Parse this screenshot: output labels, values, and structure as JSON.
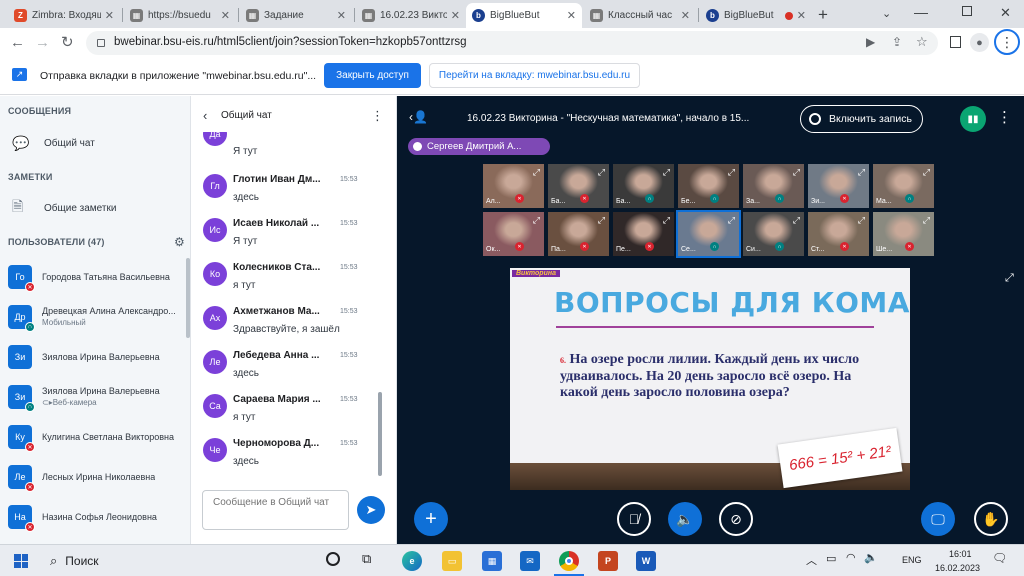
{
  "browser": {
    "tabs": [
      {
        "label": "Zimbra: Входящ",
        "fav": "Zi",
        "color": "#e04a2a"
      },
      {
        "label": "https://bsuedu",
        "fav": "b",
        "color": "#7a7a7a"
      },
      {
        "label": "Задание",
        "fav": "Z",
        "color": "#7a7a7a"
      },
      {
        "label": "16.02.23 Викто",
        "fav": "16",
        "color": "#7a7a7a"
      },
      {
        "label": "BigBlueBut",
        "fav": "b",
        "color": "#1b3f8f"
      },
      {
        "label": "Классный час",
        "fav": "K",
        "color": "#7a7a7a"
      },
      {
        "label": "BigBlueBut",
        "fav": "b",
        "color": "#1b3f8f"
      }
    ],
    "new_tab_symbol": "+",
    "url": "bwebinar.bsu-eis.ru/html5client/join?sessionToken=hzkopb57onttzrsg"
  },
  "infobar": {
    "text": "Отправка вкладки в приложение \"mwebinar.bsu.edu.ru\"...",
    "share_button": "Закрыть доступ",
    "goto_button": "Перейти на вкладку: mwebinar.bsu.edu.ru"
  },
  "sidebar": {
    "messages_header": "СООБЩЕНИЯ",
    "public_chat": "Общий чат",
    "notes_header": "ЗАМЕТКИ",
    "shared_notes": "Общие заметки",
    "users_header": "ПОЛЬЗОВАТЕЛИ (47)",
    "users": [
      {
        "initials": "Го",
        "name": "Городова Татьяна Васильевна",
        "sub": "",
        "status": "muted",
        "color": "#0f70d7"
      },
      {
        "initials": "Др",
        "name": "Древецкая Алина Александро...",
        "sub": "Мобильный",
        "status": "listen",
        "color": "#0f70d7"
      },
      {
        "initials": "Зи",
        "name": "Зиялова Ирина Валерьевна",
        "sub": "",
        "status": "",
        "color": "#0f70d7"
      },
      {
        "initials": "Зи",
        "name": "Зиялова Ирина Валерьевна",
        "sub": "⊂▸Веб-камера",
        "status": "listen",
        "color": "#0f70d7"
      },
      {
        "initials": "Ку",
        "name": "Кулигина Светлана Викторовна",
        "sub": "",
        "status": "muted",
        "color": "#0f70d7"
      },
      {
        "initials": "Ле",
        "name": "Лесных Ирина Николаевна",
        "sub": "",
        "status": "muted",
        "color": "#0f70d7"
      },
      {
        "initials": "На",
        "name": "Назина Софья Леонидовна",
        "sub": "",
        "status": "muted",
        "color": "#0f70d7"
      }
    ]
  },
  "chat": {
    "title": "Общий чат",
    "partial_text": "Я тут",
    "partial_initials": "Да",
    "messages": [
      {
        "initials": "Гл",
        "name": "Глотин Иван Дм...",
        "time": "15:53",
        "text": "здесь"
      },
      {
        "initials": "Ис",
        "name": "Исаев Николай ...",
        "time": "15:53",
        "text": "Я тут"
      },
      {
        "initials": "Ко",
        "name": "Колесников Ста...",
        "time": "15:53",
        "text": "я тут"
      },
      {
        "initials": "Ах",
        "name": "Ахметжанов Ма...",
        "time": "15:53",
        "text": "Здравствуйте, я зашёл"
      },
      {
        "initials": "Ле",
        "name": "Лебедева Анна ...",
        "time": "15:53",
        "text": "здесь"
      },
      {
        "initials": "Са",
        "name": "Сараева Мария ...",
        "time": "15:53",
        "text": "я тут"
      },
      {
        "initials": "Че",
        "name": "Черноморова Д...",
        "time": "15:53",
        "text": "здесь"
      }
    ],
    "input_placeholder": "Сообщение в Общий чат"
  },
  "main": {
    "meeting_title": "16.02.23 Викторина - \"Нескучная математика\", начало в 15...",
    "record_button": "Включить запись",
    "presenter_badge": "Сергеев Дмитрий А...",
    "videos": [
      {
        "name": "Ал...",
        "bg": "#8a6a5a",
        "status": "muted"
      },
      {
        "name": "Ба...",
        "bg": "#4a4a4a",
        "status": "muted"
      },
      {
        "name": "Ба...",
        "bg": "#3a3a3a",
        "status": "listen"
      },
      {
        "name": "Бе...",
        "bg": "#5a4a42",
        "status": "listen"
      },
      {
        "name": "За...",
        "bg": "#6a5a55",
        "status": "listen"
      },
      {
        "name": "Зи...",
        "bg": "#707a86",
        "status": "muted"
      },
      {
        "name": "Ма...",
        "bg": "#7a6a60",
        "status": "listen"
      },
      {
        "name": "Ок...",
        "bg": "#8a5a60",
        "status": "muted"
      },
      {
        "name": "Па...",
        "bg": "#6a5040",
        "status": "muted"
      },
      {
        "name": "Пе...",
        "bg": "#302828",
        "status": "muted"
      },
      {
        "name": "Се...",
        "bg": "#6a7a90",
        "status": "listen"
      },
      {
        "name": "Си...",
        "bg": "#4a4a4a",
        "status": "listen"
      },
      {
        "name": "Ст...",
        "bg": "#7a6a5a",
        "status": "muted"
      },
      {
        "name": "Ше...",
        "bg": "#8a8a80",
        "status": "muted"
      }
    ],
    "slide": {
      "tag": "Викторина",
      "heading": "ВОПРОСЫ ДЛЯ КОМАНД:",
      "question_number": "6.",
      "question": "На озере росли лилии. Каждый день их число удваивалось. На 20 день заросло всё озеро. На какой день заросло половина озера?",
      "formula": "666 = 15² + 21²"
    }
  },
  "taskbar": {
    "search": "Поиск",
    "lang": "ENG",
    "time": "16:01",
    "date": "16.02.2023"
  }
}
